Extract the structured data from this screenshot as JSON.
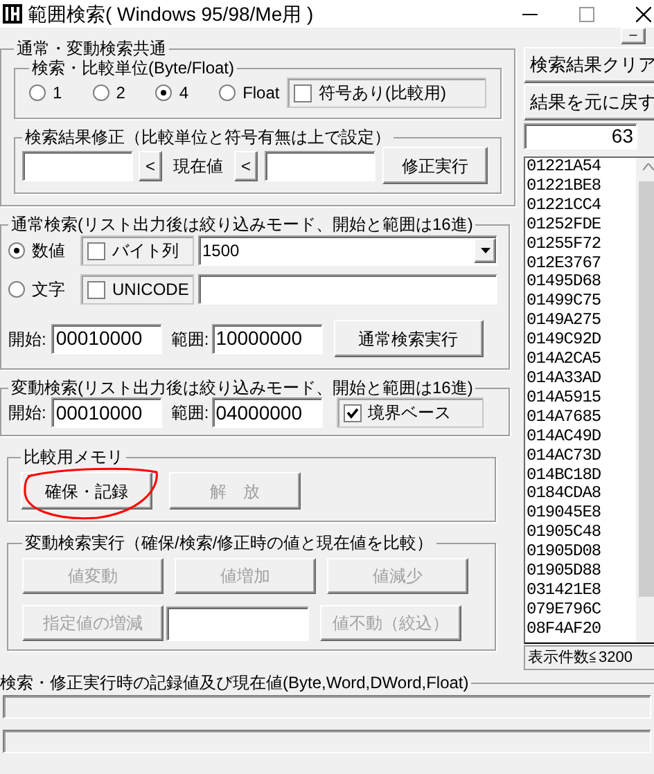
{
  "window": {
    "title": "範囲検索( Windows 95/98/Me用 )"
  },
  "common": {
    "title": "通常・変動検索共通",
    "unit": {
      "title": "検索・比較単位(Byte/Float)",
      "options": [
        {
          "label": "1",
          "selected": false
        },
        {
          "label": "2",
          "selected": false
        },
        {
          "label": "4",
          "selected": true
        },
        {
          "label": "Float",
          "selected": false
        }
      ],
      "signed": {
        "label": "符号あり(比較用)",
        "checked": false
      }
    },
    "fix": {
      "title": "検索結果修正（比較単位と符号有無は上で設定）",
      "arrow_left": "<",
      "current_label": "現在値",
      "arrow_right": "<",
      "button": "修正実行"
    }
  },
  "normal": {
    "title": "通常検索(リスト出力後は絞り込みモード、開始と範囲は16進)",
    "modes": [
      {
        "label": "数値",
        "selected": true,
        "kind": "combo",
        "option": {
          "label": "バイト列",
          "checked": false
        },
        "value": "1500"
      },
      {
        "label": "文字",
        "selected": false,
        "kind": "text",
        "option": {
          "label": "UNICODE",
          "checked": false
        }
      }
    ],
    "start_label": "開始:",
    "start": "00010000",
    "range_label": "範囲:",
    "range": "10000000",
    "button": "通常検索実行"
  },
  "dynamic": {
    "title": "変動検索(リスト出力後は絞り込みモード、開始と範囲は16進)",
    "start_label": "開始:",
    "start": "00010000",
    "range_label": "範囲:",
    "range": "04000000",
    "boundary": {
      "label": "境界ベース",
      "checked": true
    }
  },
  "memory": {
    "title": "比較用メモリ",
    "buttons": [
      {
        "label": "確保・記録",
        "disabled": false,
        "annotated": true
      },
      {
        "label": "解　放",
        "disabled": true,
        "annotated": false
      }
    ]
  },
  "execute": {
    "title": "変動検索実行（確保/検索/修正時の値と現在値を比較）",
    "rows": [
      [
        {
          "kind": "button",
          "label": "値変動",
          "disabled": true
        },
        {
          "kind": "button",
          "label": "値増加",
          "disabled": true
        },
        {
          "kind": "button",
          "label": "値減少",
          "disabled": true
        }
      ],
      [
        {
          "kind": "button",
          "label": "指定値の増減",
          "disabled": true
        },
        {
          "kind": "field"
        },
        {
          "kind": "button",
          "label": "値不動（絞込）",
          "disabled": true
        }
      ]
    ]
  },
  "results": {
    "top_button": "–",
    "buttons": [
      "検索結果クリア",
      "結果を元に戻す"
    ],
    "count": "63",
    "items": [
      "01221A54",
      "01221BE8",
      "01221CC4",
      "01252FDE",
      "01255F72",
      "012E3767",
      "01495D68",
      "01499C75",
      "0149A275",
      "0149C92D",
      "014A2CA5",
      "014A33AD",
      "014A5915",
      "014A7685",
      "014AC49D",
      "014AC73D",
      "014BC18D",
      "0184CDA8",
      "019045E8",
      "01905C48",
      "01905D08",
      "01905D88",
      "031421E8",
      "079E796C",
      "08F4AF20"
    ],
    "limit": "表示件数≦3200"
  },
  "record": {
    "title": "検索・修正実行時の記録値及び現在値(Byte,Word,DWord,Float)"
  }
}
